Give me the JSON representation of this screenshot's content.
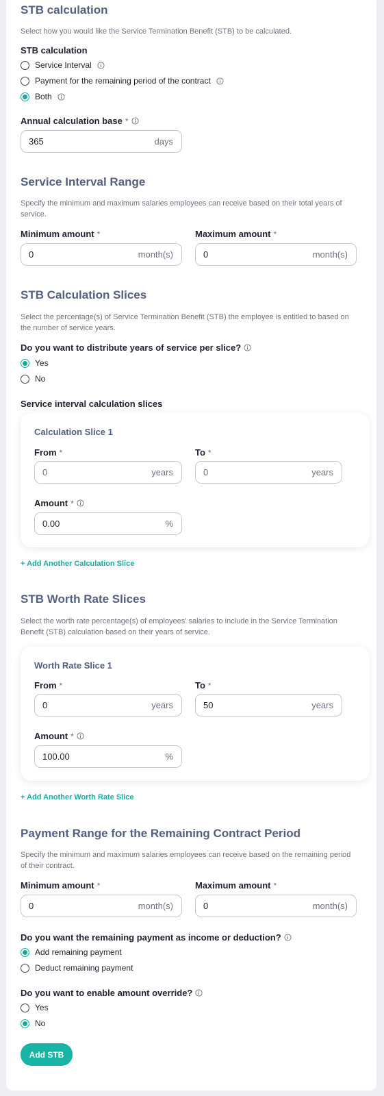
{
  "stb": {
    "title": "STB calculation",
    "description": "Select how you would like the Service Termination Benefit (STB) to be calculated.",
    "method_label": "STB calculation",
    "options": [
      "Service Interval",
      "Payment for the remaining period of the contract",
      "Both"
    ],
    "selected": "Both",
    "annual_base_label": "Annual calculation base",
    "annual_base_value": "365",
    "annual_base_unit": "days"
  },
  "service_interval": {
    "title": "Service Interval Range",
    "description": "Specify the minimum and maximum salaries employees can receive based on their total years of service.",
    "min_label": "Minimum amount",
    "min_value": "0",
    "max_label": "Maximum amount",
    "max_value": "0",
    "unit": "month(s)"
  },
  "calc_slices": {
    "title": "STB Calculation Slices",
    "description": "Select the percentage(s) of Service Termination Benefit (STB) the employee is entitled to based on the number of service years.",
    "distribute_label": "Do you want to distribute years of service per slice?",
    "distribute_options": [
      "Yes",
      "No"
    ],
    "distribute_selected": "Yes",
    "list_label": "Service interval calculation slices",
    "slice": {
      "title": "Calculation Slice 1",
      "from_label": "From",
      "from_value": "0",
      "to_label": "To",
      "to_value": "0",
      "years_unit": "years",
      "amount_label": "Amount",
      "amount_value": "0.00",
      "percent_unit": "%"
    },
    "add_label": "+ Add Another Calculation Slice"
  },
  "worth_slices": {
    "title": "STB Worth Rate Slices",
    "description": "Select the worth rate percentage(s) of employees' salaries to include in the Service Termination Benefit (STB) calculation based on their years of service.",
    "slice": {
      "title": "Worth Rate Slice 1",
      "from_label": "From",
      "from_value": "0",
      "to_label": "To",
      "to_value": "50",
      "years_unit": "years",
      "amount_label": "Amount",
      "amount_value": "100.00",
      "percent_unit": "%"
    },
    "add_label": "+ Add Another Worth Rate Slice"
  },
  "remaining": {
    "title": "Payment Range for the Remaining Contract Period",
    "description": "Specify the minimum and maximum salaries employees can receive based on the remaining period of their contract.",
    "min_label": "Minimum amount",
    "min_value": "0",
    "max_label": "Maximum amount",
    "max_value": "0",
    "unit": "month(s)",
    "payment_type_label": "Do you want the remaining payment as income or deduction?",
    "payment_type_options": [
      "Add remaining payment",
      "Deduct remaining payment"
    ],
    "payment_type_selected": "Add remaining payment",
    "override_label": "Do you want to enable amount override?",
    "override_options": [
      "Yes",
      "No"
    ],
    "override_selected": "No"
  },
  "required_mark": "*",
  "submit_label": "Add STB",
  "colors": {
    "accent": "#18a99e",
    "heading": "#53607f",
    "button": "#18b4a5"
  }
}
